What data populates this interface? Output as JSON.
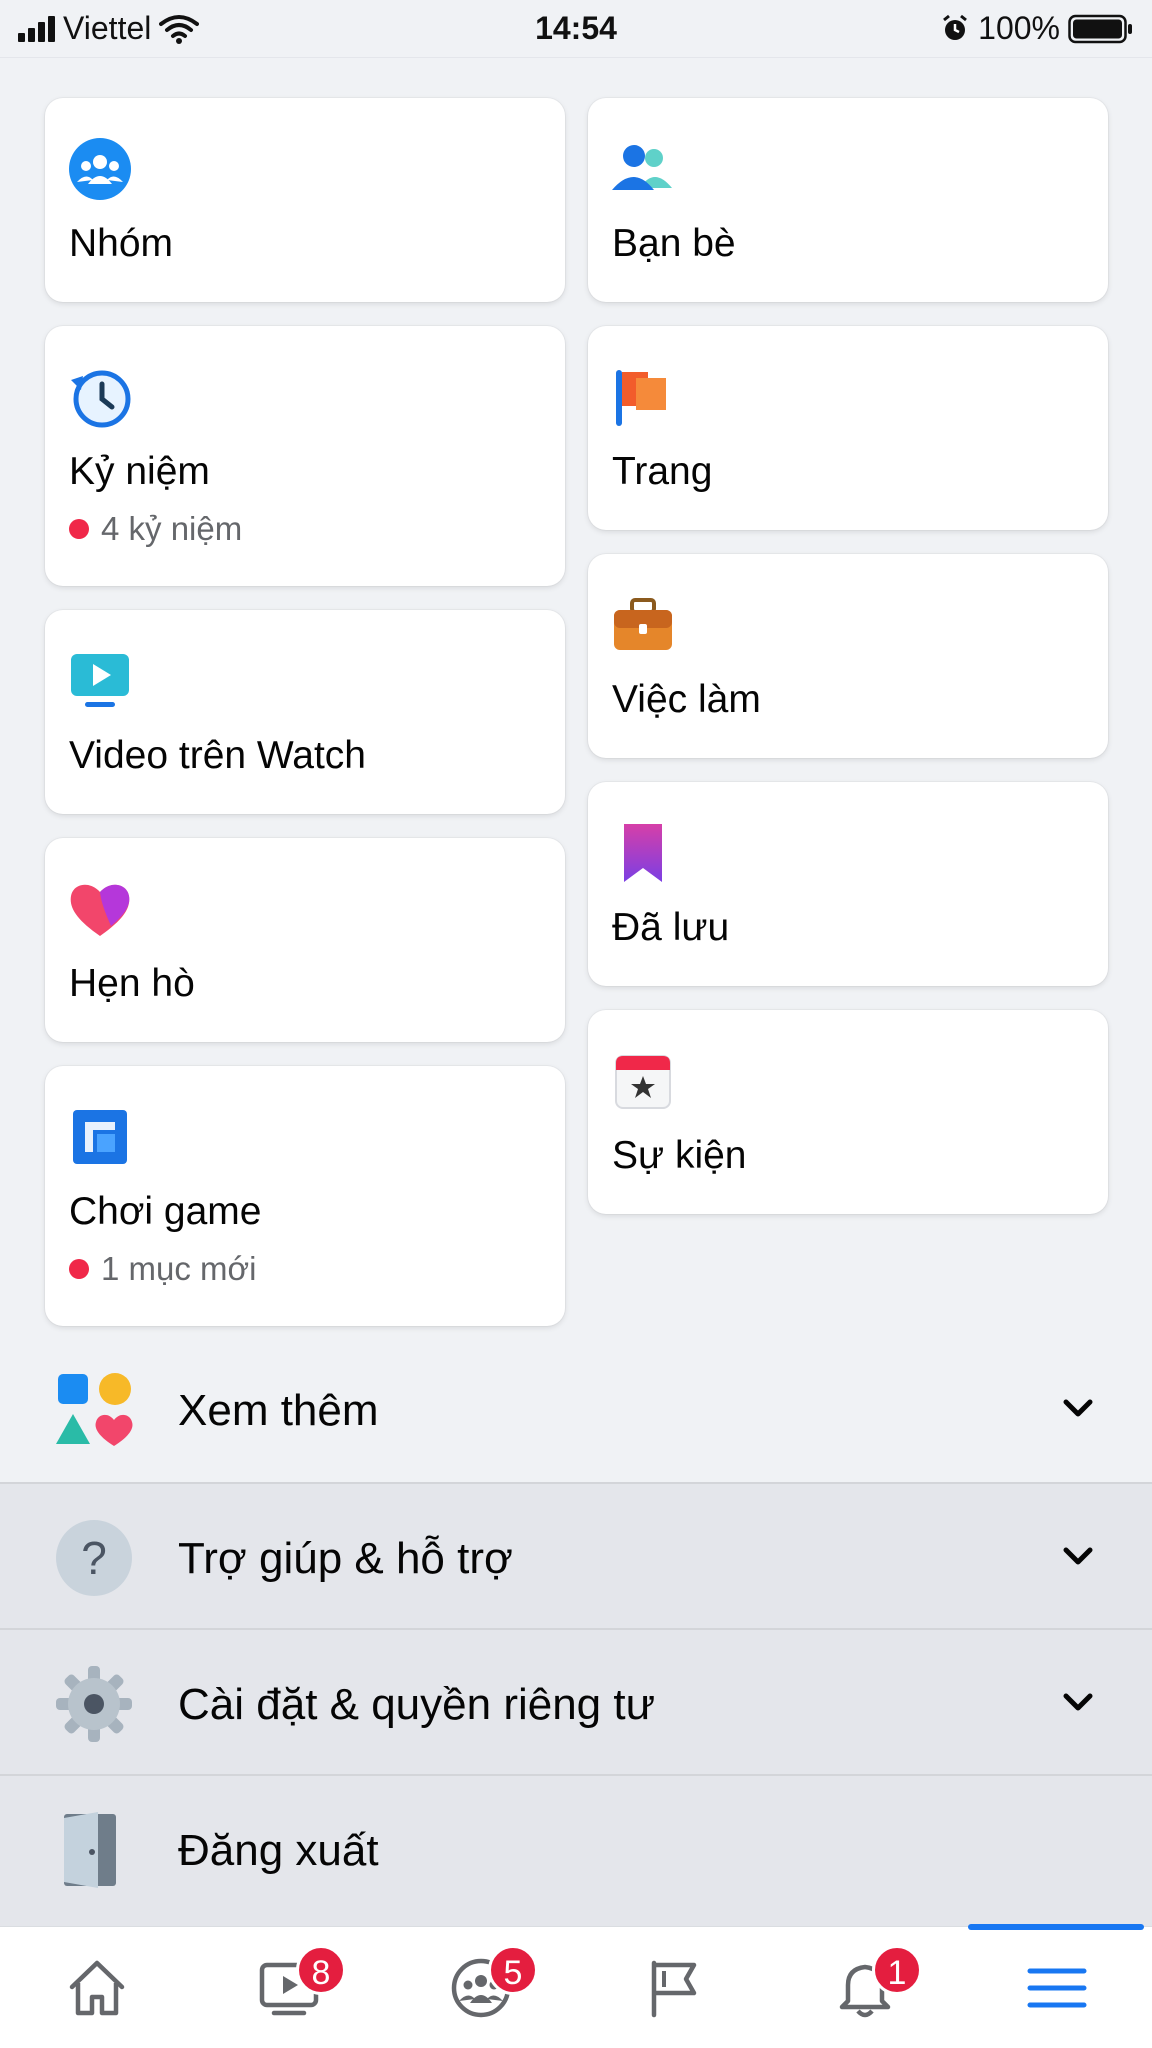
{
  "status_bar": {
    "carrier": "Viettel",
    "time": "14:54",
    "battery": "100%"
  },
  "shortcuts_left": [
    {
      "label": "Nhóm",
      "icon": "groups-icon"
    },
    {
      "label": "Kỷ niệm",
      "sub": "4 kỷ niệm",
      "icon": "memories-icon"
    },
    {
      "label": "Video trên Watch",
      "icon": "watch-video-icon"
    },
    {
      "label": "Hẹn hò",
      "icon": "dating-heart-icon"
    },
    {
      "label": "Chơi game",
      "sub": "1 mục mới",
      "icon": "gaming-icon"
    }
  ],
  "shortcuts_right": [
    {
      "label": "Bạn bè",
      "icon": "friends-icon"
    },
    {
      "label": "Trang",
      "icon": "pages-flag-icon"
    },
    {
      "label": "Việc làm",
      "icon": "jobs-briefcase-icon"
    },
    {
      "label": "Đã lưu",
      "icon": "saved-bookmark-icon"
    },
    {
      "label": "Sự kiện",
      "icon": "events-calendar-icon"
    }
  ],
  "rows": [
    {
      "label": "Xem thêm",
      "icon": "see-more-shapes-icon"
    },
    {
      "label": "Trợ giúp & hỗ trợ",
      "icon": "help-question-icon"
    },
    {
      "label": "Cài đặt & quyền riêng tư",
      "icon": "settings-gear-icon"
    },
    {
      "label": "Đăng xuất",
      "icon": "logout-door-icon"
    }
  ],
  "tabbar": {
    "watch_badge": "8",
    "groups_badge": "5",
    "notifications_badge": "1"
  },
  "colors": {
    "accent": "#1877f2",
    "badge": "#e41e3f",
    "background": "#f0f2f5"
  }
}
